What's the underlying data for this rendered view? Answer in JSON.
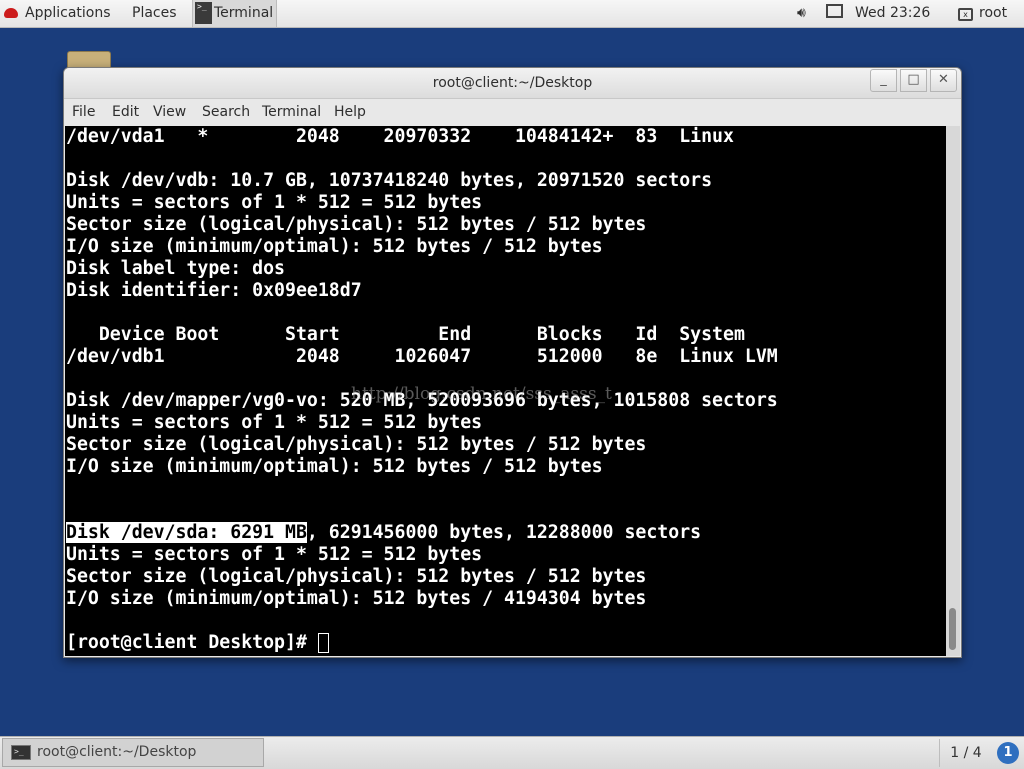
{
  "top_panel": {
    "applications_label": "Applications",
    "places_label": "Places",
    "active_app_label": "Terminal",
    "clock": "Wed 23:26",
    "user": "root",
    "icons": {
      "applications": "redhat-hat-icon",
      "volume": "volume-icon",
      "network": "network-icon",
      "user": "user-icon"
    }
  },
  "window": {
    "title": "root@client:~/Desktop",
    "controls": {
      "minimize": "_",
      "maximize": "□",
      "close": "✕"
    },
    "menu": [
      "File",
      "Edit",
      "View",
      "Search",
      "Terminal",
      "Help"
    ]
  },
  "terminal": {
    "lines": [
      "/dev/vda1   *        2048    20970332    10484142+  83  Linux",
      "",
      "Disk /dev/vdb: 10.7 GB, 10737418240 bytes, 20971520 sectors",
      "Units = sectors of 1 * 512 = 512 bytes",
      "Sector size (logical/physical): 512 bytes / 512 bytes",
      "I/O size (minimum/optimal): 512 bytes / 512 bytes",
      "Disk label type: dos",
      "Disk identifier: 0x09ee18d7",
      "",
      "   Device Boot      Start         End      Blocks   Id  System",
      "/dev/vdb1            2048     1026047      512000   8e  Linux LVM",
      "",
      "Disk /dev/mapper/vg0-vo: 520 MB, 520093696 bytes, 1015808 sectors",
      "Units = sectors of 1 * 512 = 512 bytes",
      "Sector size (logical/physical): 512 bytes / 512 bytes",
      "I/O size (minimum/optimal): 512 bytes / 512 bytes",
      "",
      "",
      "",
      "Units = sectors of 1 * 512 = 512 bytes",
      "Sector size (logical/physical): 512 bytes / 512 bytes",
      "I/O size (minimum/optimal): 512 bytes / 4194304 bytes",
      ""
    ],
    "highlighted_line": {
      "selected": "Disk /dev/sda: 6291 MB",
      "rest": ", 6291456000 bytes, 12288000 sectors"
    },
    "prompt": "[root@client Desktop]# ",
    "watermark": "http://blog.csdn.net/sss_asss_t"
  },
  "bottom_panel": {
    "task_label": "root@client:~/Desktop",
    "workspace": "1 / 4",
    "notification": "1"
  }
}
